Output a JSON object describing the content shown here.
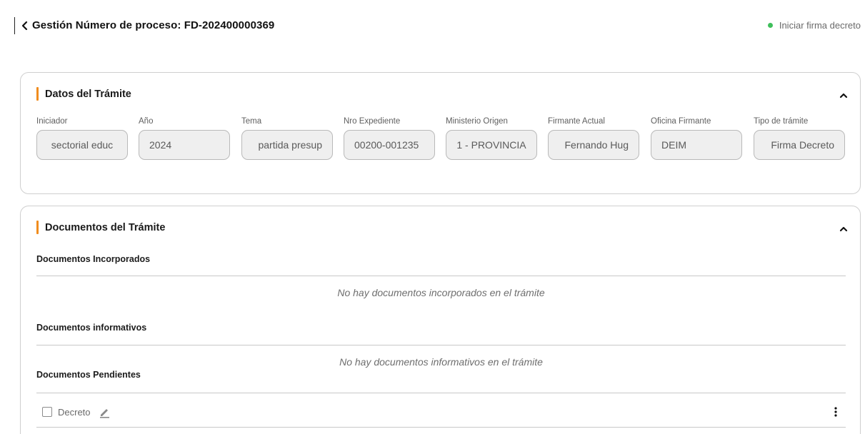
{
  "header": {
    "title": "Gestión Número de proceso: FD-202400000369",
    "status_label": "Iniciar firma decreto",
    "status_color": "#3fbf5b",
    "back_icon": "chevron-left-icon"
  },
  "accent_color": "#f08c1e",
  "datos": {
    "title": "Datos del Trámite",
    "collapse_icon": "chevron-up-icon",
    "fields": [
      {
        "label": "Iniciador",
        "value": "sectorial educ"
      },
      {
        "label": "Año",
        "value": "2024"
      },
      {
        "label": "Tema",
        "value": "partida presup"
      },
      {
        "label": "Nro Expediente",
        "value": "00200-001235"
      },
      {
        "label": "Ministerio Origen",
        "value": "1 - PROVINCIA"
      },
      {
        "label": "Firmante Actual",
        "value": "Fernando Hug"
      },
      {
        "label": "Oficina Firmante",
        "value": "DEIM"
      },
      {
        "label": "Tipo de trámite",
        "value": "Firma Decreto"
      }
    ]
  },
  "documentos": {
    "title": "Documentos del Trámite",
    "collapse_icon": "chevron-up-icon",
    "incorporados": {
      "heading": "Documentos Incorporados",
      "empty_message": "No hay documentos incorporados en el trámite"
    },
    "informativos": {
      "heading": "Documentos informativos",
      "empty_message": "No hay documentos informativos en el trámite"
    },
    "pendientes": {
      "heading": "Documentos Pendientes",
      "items": [
        {
          "name": "Decreto",
          "checked": false,
          "edit_icon": "pencil-icon",
          "menu_icon": "more-vertical-icon"
        }
      ]
    }
  }
}
